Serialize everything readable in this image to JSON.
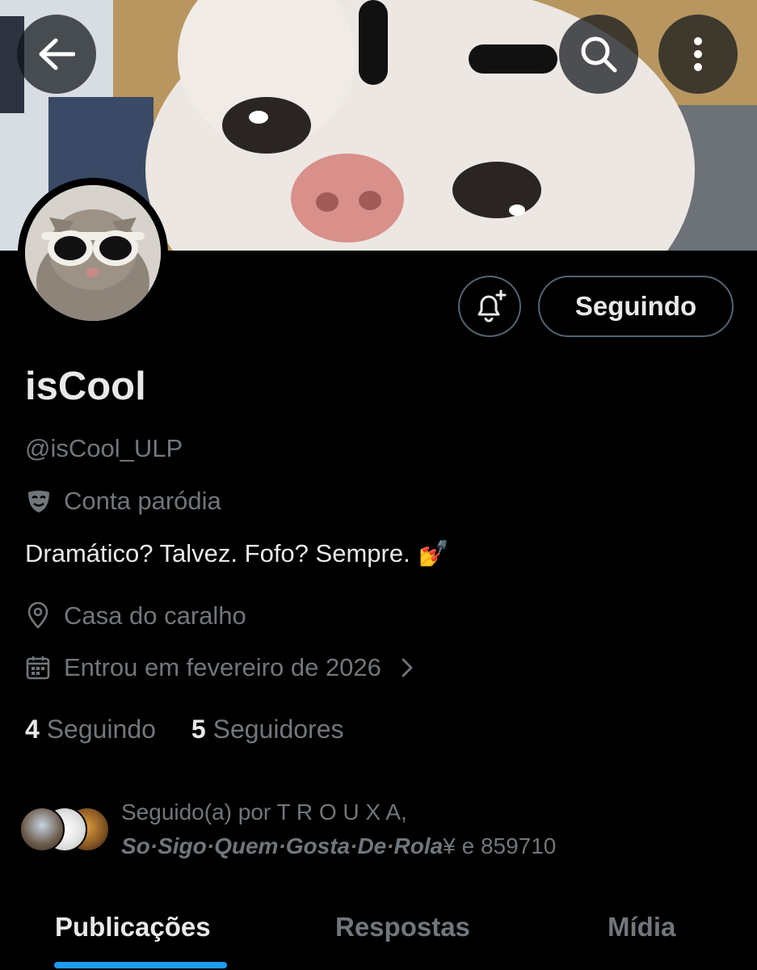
{
  "header": {
    "back_icon": "arrow-left-icon",
    "search_icon": "search-icon",
    "more_icon": "more-vertical-icon"
  },
  "profile": {
    "display_name": "isCool",
    "handle": "@isCool_ULP",
    "parody_label": "Conta paródia",
    "parody_icon": "mask-icon",
    "bio": "Dramático? Talvez. Fofo? Sempre.",
    "bio_emoji": "💅",
    "location": "Casa do caralho",
    "location_icon": "location-pin-icon",
    "joined": "Entrou em fevereiro de 2026",
    "joined_icon": "calendar-icon"
  },
  "actions": {
    "notify_icon": "bell-plus-icon",
    "follow_label": "Seguindo"
  },
  "stats": {
    "following_count": "4",
    "following_label": "Seguindo",
    "followers_count": "5",
    "followers_label": "Seguidores"
  },
  "followed_by": {
    "line1": "Seguido(a) por T R O U X A,",
    "name2": "So·Sigo·Quem·Gosta·De·Rola",
    "line2_rest": "¥ e 859710"
  },
  "tabs": [
    {
      "label": "Publicações",
      "active": true
    },
    {
      "label": "Respostas",
      "active": false
    },
    {
      "label": "Mídia",
      "active": false
    }
  ],
  "colors": {
    "background": "#000000",
    "text_primary": "#e7e9ea",
    "text_secondary": "#71767b",
    "border": "#536471",
    "accent": "#1d9bf0"
  }
}
